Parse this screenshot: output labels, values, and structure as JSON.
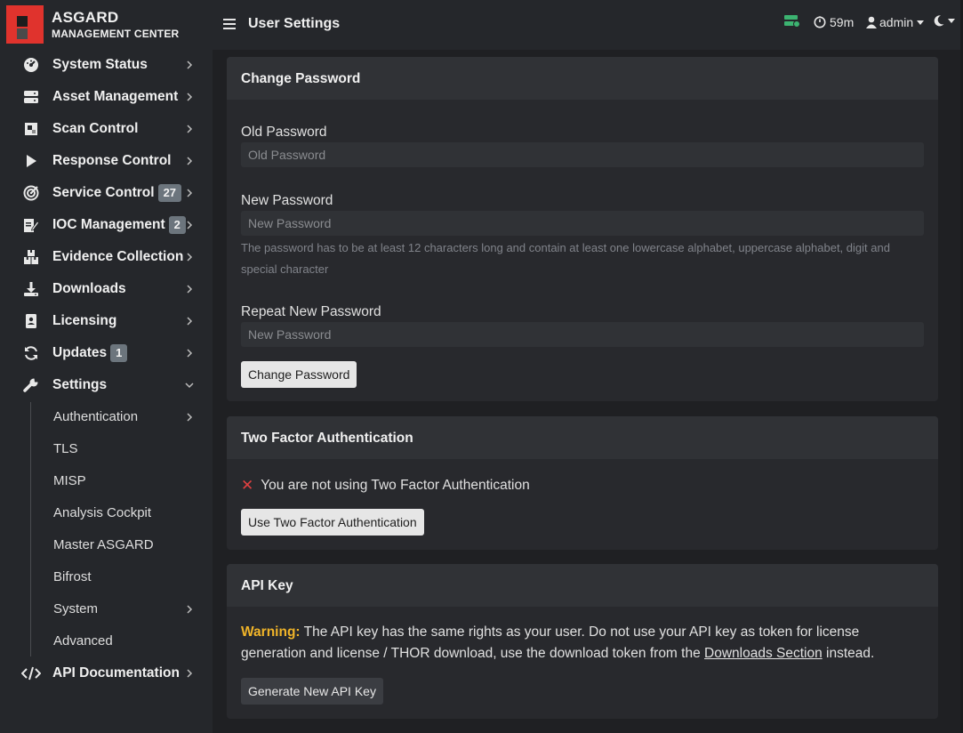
{
  "brand": {
    "title": "ASGARD",
    "subtitle": "MANAGEMENT CENTER"
  },
  "topbar": {
    "title": "User Settings",
    "session_time": "59m",
    "user": "admin"
  },
  "sidebar": {
    "items": [
      {
        "label": "System Status",
        "icon": "dashboard-gauge-icon"
      },
      {
        "label": "Asset Management",
        "icon": "server-icon"
      },
      {
        "label": "Scan Control",
        "icon": "scan-square-icon"
      },
      {
        "label": "Response Control",
        "icon": "play-icon"
      },
      {
        "label": "Service Control",
        "icon": "target-icon",
        "badge": "27"
      },
      {
        "label": "IOC Management",
        "icon": "edit-document-icon",
        "badge": "2"
      },
      {
        "label": "Evidence Collection",
        "icon": "boxes-icon"
      },
      {
        "label": "Downloads",
        "icon": "download-icon"
      },
      {
        "label": "Licensing",
        "icon": "id-card-icon"
      },
      {
        "label": "Updates",
        "icon": "sync-icon",
        "badge": "1"
      },
      {
        "label": "Settings",
        "icon": "wrench-icon"
      }
    ],
    "settings_sub": [
      {
        "label": "Authentication"
      },
      {
        "label": "TLS"
      },
      {
        "label": "MISP"
      },
      {
        "label": "Analysis Cockpit"
      },
      {
        "label": "Master ASGARD"
      },
      {
        "label": "Bifrost"
      },
      {
        "label": "System"
      },
      {
        "label": "Advanced"
      }
    ],
    "api_doc": {
      "label": "API Documentation",
      "icon": "code-icon"
    }
  },
  "change_password": {
    "title": "Change Password",
    "old_label": "Old Password",
    "old_placeholder": "Old Password",
    "new_label": "New Password",
    "new_placeholder": "New Password",
    "help": "The password has to be at least 12 characters long and contain at least one lowercase alphabet, uppercase alphabet, digit and special character",
    "repeat_label": "Repeat New Password",
    "repeat_placeholder": "New Password",
    "button": "Change Password"
  },
  "two_factor": {
    "title": "Two Factor Authentication",
    "status": "You are not using Two Factor Authentication",
    "button": "Use Two Factor Authentication"
  },
  "api_key": {
    "title": "API Key",
    "warning_label": "Warning:",
    "warning_text": "The API key has the same rights as your user. Do not use your API key as token for license generation and license / THOR download, use the download token from the",
    "link": "Downloads Section",
    "suffix": "instead.",
    "button": "Generate New API Key"
  },
  "colors": {
    "accent_red": "#e0332d",
    "warning": "#f0b429",
    "status_green": "#3cb371",
    "error_x": "#e04040"
  }
}
